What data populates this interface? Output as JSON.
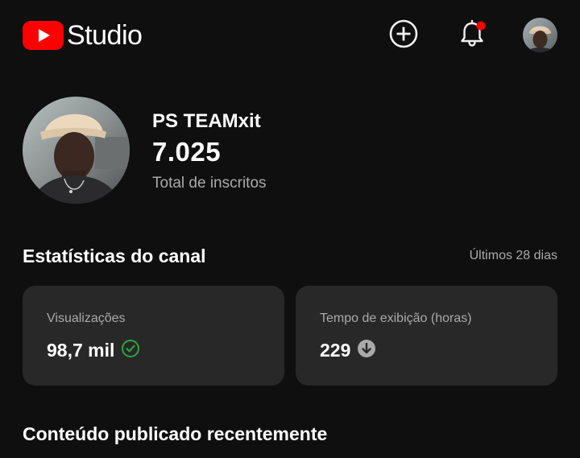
{
  "header": {
    "brand_text": "Studio",
    "create_icon": "add-circle-icon",
    "notifications_icon": "bell-icon",
    "has_unread_notifications": true,
    "brand_color": "#ff0000"
  },
  "channel": {
    "name": "PS TEAMxit",
    "subscriber_count": "7.025",
    "subscriber_label": "Total de inscritos"
  },
  "stats": {
    "title": "Estatísticas do canal",
    "period": "Últimos 28 dias",
    "cards": [
      {
        "label": "Visualizações",
        "value": "98,7 mil",
        "trend_icon": "check-circle-icon",
        "trend_color": "#2ba640"
      },
      {
        "label": "Tempo de exibição (horas)",
        "value": "229",
        "trend_icon": "arrow-down-circle-icon",
        "trend_color": "#aaaaaa"
      }
    ]
  },
  "recent": {
    "title": "Conteúdo publicado recentemente"
  }
}
